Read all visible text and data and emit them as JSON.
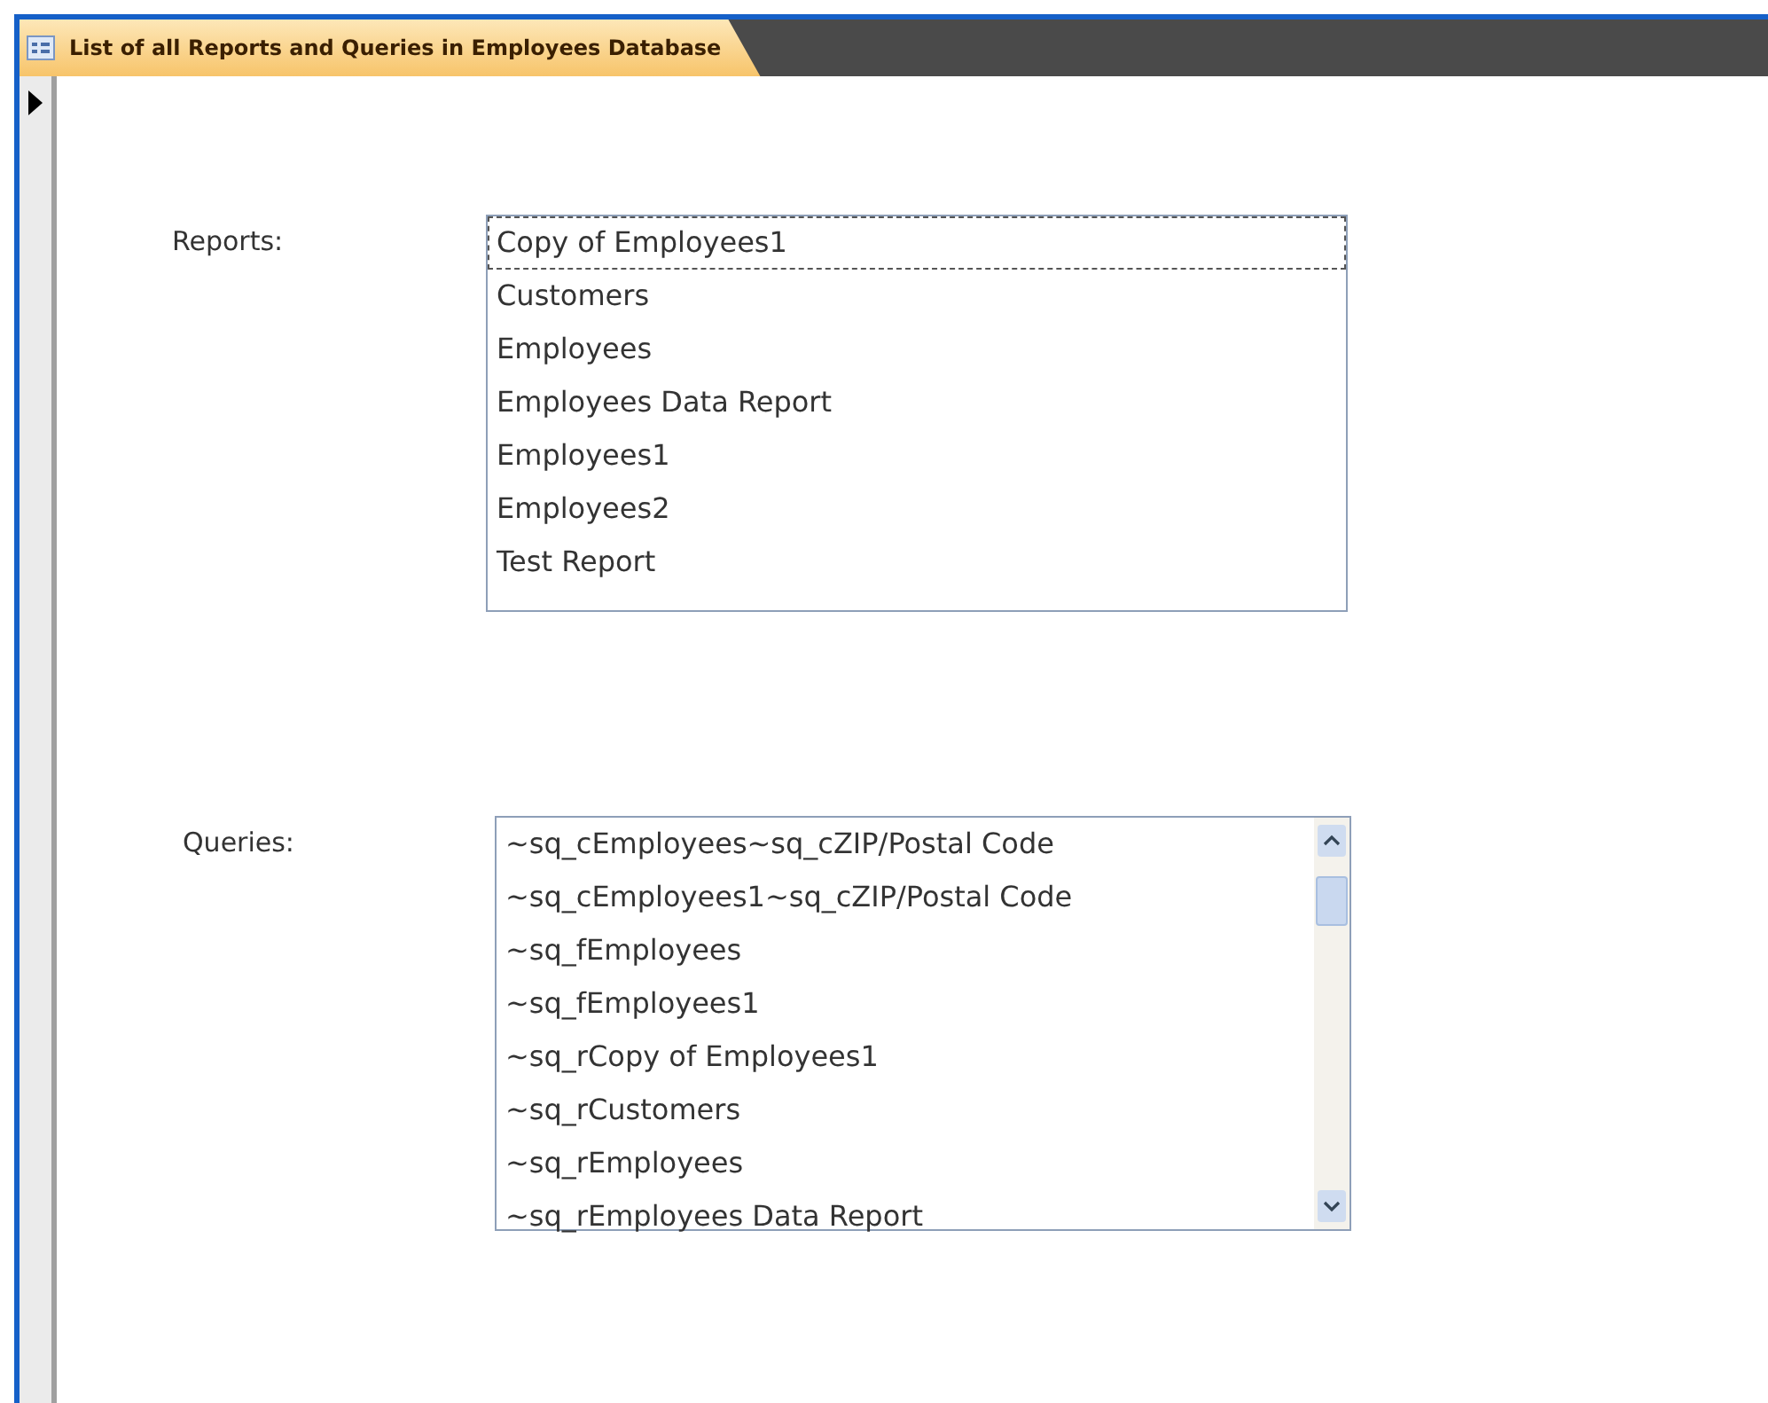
{
  "tab": {
    "title": "List of all Reports and Queries in Employees Database",
    "selected": true
  },
  "reports": {
    "label": "Reports:",
    "items": [
      {
        "text": "Copy of Employees1",
        "focused": true
      },
      {
        "text": "Customers",
        "focused": false
      },
      {
        "text": "Employees",
        "focused": false
      },
      {
        "text": "Employees Data Report",
        "focused": false
      },
      {
        "text": "Employees1",
        "focused": false
      },
      {
        "text": "Employees2",
        "focused": false
      },
      {
        "text": "Test Report",
        "focused": false
      }
    ]
  },
  "queries": {
    "label": "Queries:",
    "items": [
      {
        "text": "~sq_cEmployees~sq_cZIP/Postal Code",
        "focused": false
      },
      {
        "text": "~sq_cEmployees1~sq_cZIP/Postal Code",
        "focused": false
      },
      {
        "text": "~sq_fEmployees",
        "focused": false
      },
      {
        "text": "~sq_fEmployees1",
        "focused": false
      },
      {
        "text": "~sq_rCopy of Employees1",
        "focused": false
      },
      {
        "text": "~sq_rCustomers",
        "focused": false
      },
      {
        "text": "~sq_rEmployees",
        "focused": false
      },
      {
        "text": "~sq_rEmployees Data Report",
        "focused": false
      }
    ]
  }
}
